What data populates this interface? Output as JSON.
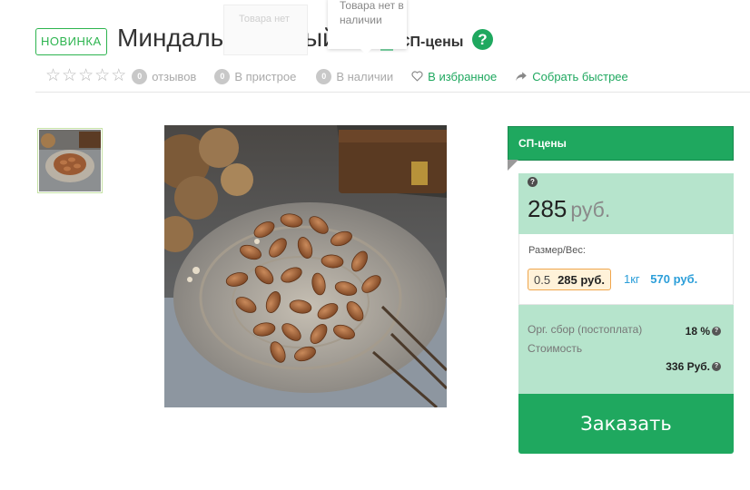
{
  "product": {
    "badge": "НОВИНКА",
    "title": "Миндаль жареный",
    "sp_label": "СП-цены",
    "help_icon": "?"
  },
  "tooltips": {
    "ghost_text": "Товара нет",
    "active_text": "Товара нет в наличии"
  },
  "meta": {
    "rating_stars": 0,
    "reviews_count": "0",
    "reviews_label": "отзывов",
    "pristroy_count": "0",
    "pristroy_label": "В пристрое",
    "stock_count": "0",
    "stock_label": "В наличии",
    "favorite_label": "В избранное",
    "collect_label": "Собрать быстрее"
  },
  "panel": {
    "header": "СП-цены",
    "price_help": "?",
    "price_value": "285",
    "price_currency": "руб.",
    "size_label": "Размер/Вес:",
    "options": [
      {
        "size": "0.5",
        "price": "285 руб.",
        "selected": true
      },
      {
        "size": "1кг",
        "price": "570 руб.",
        "selected": false
      }
    ],
    "fee_label": "Орг. сбор (постоплата)",
    "fee_value": "18 %",
    "cost_label": "Стоимость",
    "cost_value": "336 Руб.",
    "order_button": "Заказать"
  },
  "colors": {
    "accent_green": "#1fa85f",
    "light_green": "#b6e4cc",
    "option_orange": "#f0a64e",
    "link_blue": "#2b9ed9"
  },
  "icons": [
    "wrench-icon",
    "question-circle-icon",
    "star-outline-icon",
    "heart-outline-icon",
    "share-arrow-icon"
  ]
}
